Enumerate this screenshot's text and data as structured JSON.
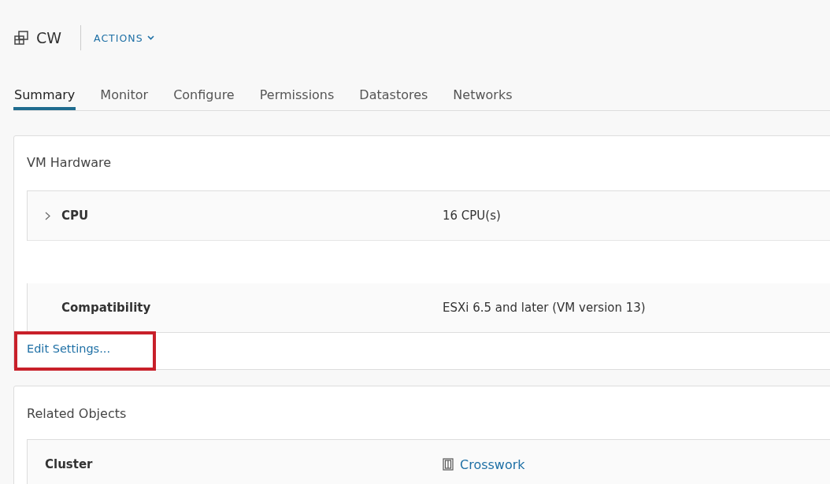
{
  "header": {
    "title": "CW",
    "actions": "ACTIONS"
  },
  "tabs": [
    {
      "label": "Summary",
      "selected": true
    },
    {
      "label": "Monitor",
      "selected": false
    },
    {
      "label": "Configure",
      "selected": false
    },
    {
      "label": "Permissions",
      "selected": false
    },
    {
      "label": "Datastores",
      "selected": false
    },
    {
      "label": "Networks",
      "selected": false
    }
  ],
  "vm_hardware": {
    "title": "VM Hardware",
    "rows": [
      {
        "label": "CPU",
        "value": "16 CPU(s)",
        "expandable": true
      },
      {
        "kind": "redacted"
      },
      {
        "label": "Compatibility",
        "value": "ESXi 6.5 and later (VM version 13)",
        "expandable": false
      }
    ],
    "link": {
      "label": "Edit Settings...",
      "highlighted": true
    }
  },
  "related_objects": {
    "title": "Related Objects",
    "rows": [
      {
        "label": "Cluster",
        "value": "Crosswork"
      }
    ]
  }
}
